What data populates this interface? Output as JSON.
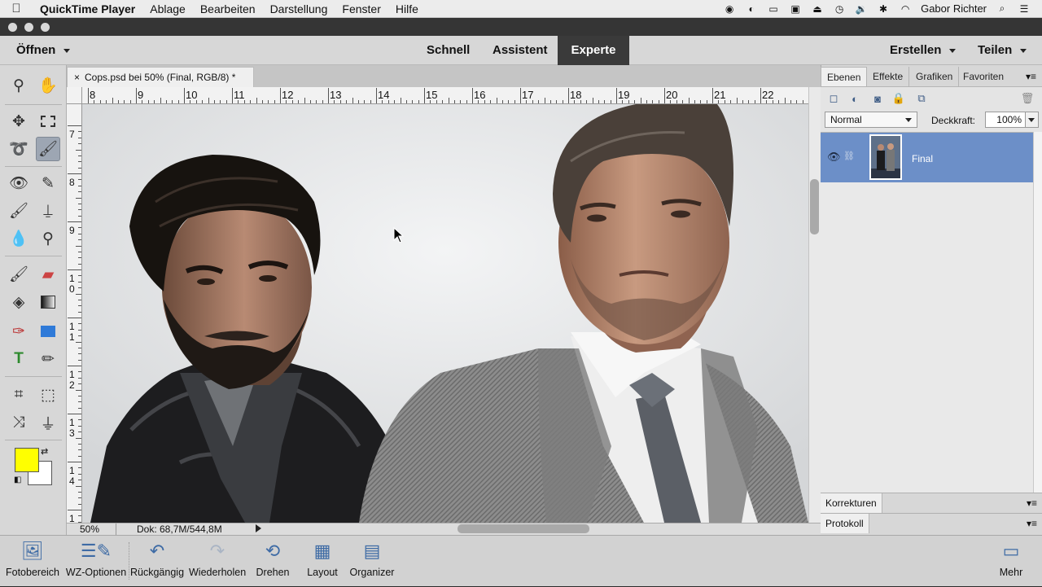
{
  "menubar": {
    "app": "QuickTime Player",
    "items": [
      "Ablage",
      "Bearbeiten",
      "Darstellung",
      "Fenster",
      "Hilfe"
    ],
    "user": "Gabor Richter"
  },
  "modebar": {
    "open_label": "Öffnen",
    "modes": [
      "Schnell",
      "Assistent",
      "Experte"
    ],
    "create_label": "Erstellen",
    "share_label": "Teilen"
  },
  "document": {
    "tab_close": "×",
    "tab_title": "Cops.psd bei 50% (Final, RGB/8) *",
    "ruler_top": [
      "8",
      "9",
      "10",
      "11",
      "12",
      "13",
      "14",
      "15",
      "16",
      "17",
      "18",
      "19",
      "20",
      "21",
      "22"
    ],
    "ruler_left": [
      "7",
      "8",
      "9",
      "1 0",
      "1 1",
      "1 2",
      "1 3",
      "1 4",
      "1"
    ],
    "zoom": "50%",
    "doc_size": "Dok: 68,7M/544,8M"
  },
  "colors": {
    "foreground": "#ffff00",
    "background": "#ffffff",
    "accent": "#3e6ba5",
    "layer_selected": "#6c8fc8"
  },
  "panel": {
    "tabs": [
      "Ebenen",
      "Effekte",
      "Grafiken",
      "Favoriten"
    ],
    "blend_mode": "Normal",
    "opacity_label": "Deckkraft:",
    "opacity_value": "100%",
    "layer_name": "Final",
    "korrekturen": "Korrekturen",
    "protokoll": "Protokoll"
  },
  "bottombar": {
    "items": [
      "Fotobereich",
      "WZ-Optionen",
      "Rückgängig",
      "Wiederholen",
      "Drehen",
      "Layout",
      "Organizer"
    ],
    "more": "Mehr"
  }
}
